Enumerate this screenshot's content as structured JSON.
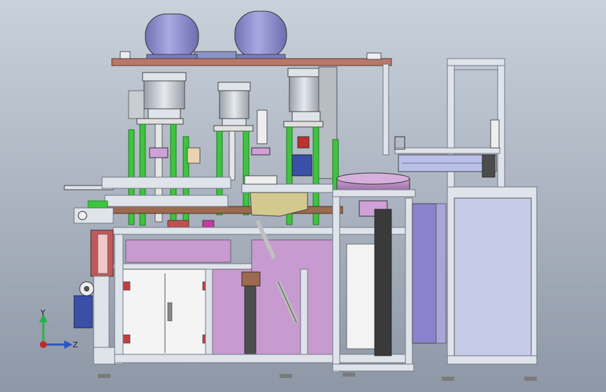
{
  "view": {
    "background_top": "#c9d1db",
    "background_bottom": "#8e97a6"
  },
  "colors": {
    "frame": "#dfe3ea",
    "frame_edge": "#6f7785",
    "tank": "#8f8fcf",
    "green_rod": "#3ec43e",
    "green_dark": "#1f7d1f",
    "brown_plate": "#9b6a4f",
    "pink_panel": "#c79ad0",
    "purple_panel": "#8a83cc",
    "cylinder_gray": "#c8ccd3",
    "red_accent": "#c03030",
    "blue_motor": "#3a4fa6"
  },
  "triad": {
    "y_label": "Y",
    "z_label": "Z",
    "y_color": "#2bb04a",
    "z_color": "#2a56c6",
    "origin_color": "#c02a2a"
  },
  "components": [
    {
      "name": "air-tank-left",
      "icon": "cylinder-tank-icon"
    },
    {
      "name": "air-tank-right",
      "icon": "cylinder-tank-icon"
    },
    {
      "name": "press-station-1",
      "icon": "pneumatic-press-icon"
    },
    {
      "name": "press-station-2",
      "icon": "pneumatic-press-icon"
    },
    {
      "name": "press-station-3",
      "icon": "pneumatic-press-icon"
    },
    {
      "name": "rotary-table",
      "icon": "turntable-icon"
    },
    {
      "name": "gantry-frame",
      "icon": "gantry-icon"
    },
    {
      "name": "control-cabinet",
      "icon": "cabinet-icon"
    },
    {
      "name": "drive-motor",
      "icon": "motor-icon"
    }
  ]
}
